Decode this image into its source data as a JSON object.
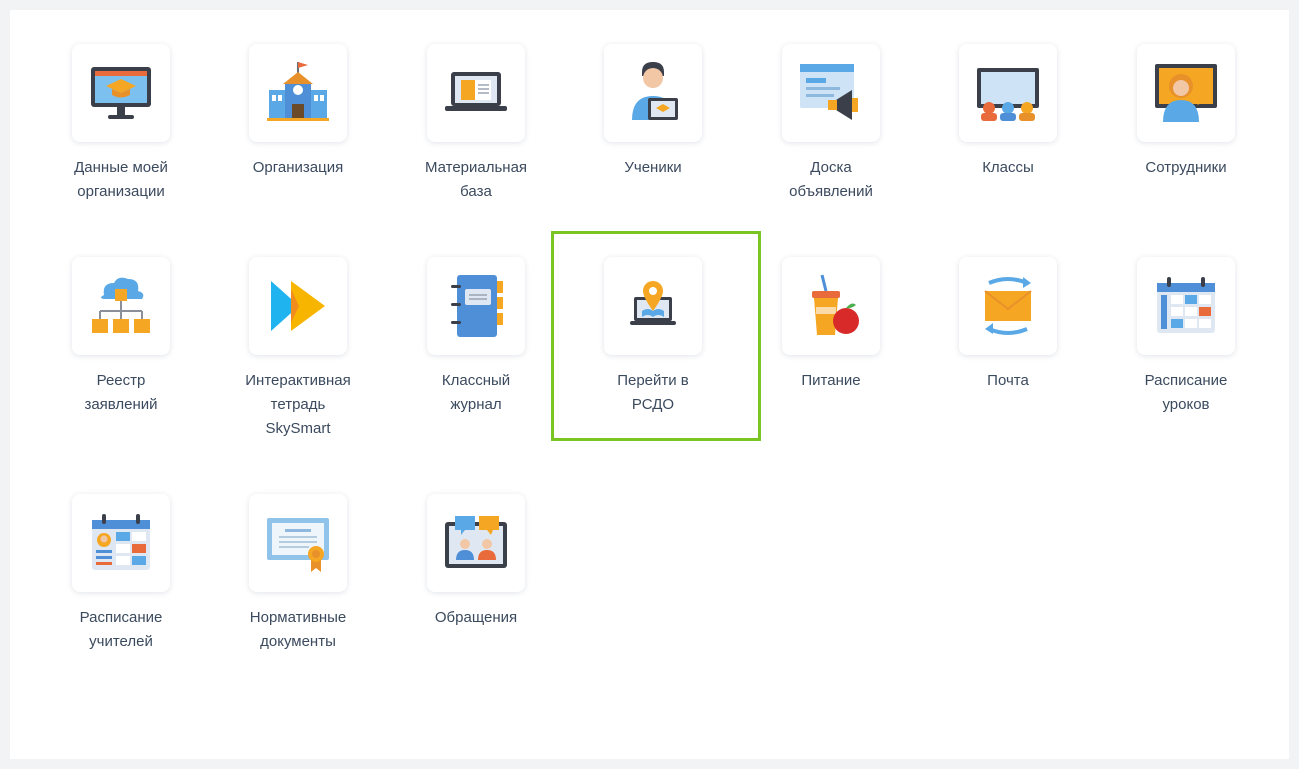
{
  "tiles": [
    {
      "label": "Данные моей\nорганизации",
      "icon": "monitor-graduation-cap-icon"
    },
    {
      "label": "Организация",
      "icon": "school-building-icon"
    },
    {
      "label": "Материальная\nбаза",
      "icon": "laptop-document-icon"
    },
    {
      "label": "Ученики",
      "icon": "student-laptop-icon"
    },
    {
      "label": "Доска\nобъявлений",
      "icon": "announcement-board-megaphone-icon"
    },
    {
      "label": "Классы",
      "icon": "classroom-board-icon"
    },
    {
      "label": "Сотрудники",
      "icon": "teacher-board-icon"
    },
    {
      "label": "Реестр\nзаявлений",
      "icon": "cloud-network-icon"
    },
    {
      "label": "Интерактивная\nтетрадь\nSkySmart",
      "icon": "play-arrows-icon"
    },
    {
      "label": "Классный\nжурнал",
      "icon": "notebook-journal-icon"
    },
    {
      "label": "Перейти в\nРСДО",
      "icon": "laptop-location-pin-icon"
    },
    {
      "label": "Питание",
      "icon": "drink-apple-icon"
    },
    {
      "label": "Почта",
      "icon": "envelope-sync-icon"
    },
    {
      "label": "Расписание\nуроков",
      "icon": "calendar-schedule-icon"
    },
    {
      "label": "Расписание\nучителей",
      "icon": "calendar-teacher-icon"
    },
    {
      "label": "Нормативные\nдокументы",
      "icon": "certificate-icon"
    },
    {
      "label": "Обращения",
      "icon": "chat-people-icon"
    }
  ],
  "highlighted_tile": "Перейти в\nРСДО",
  "colors": {
    "highlight_border": "#7ac520",
    "label_text": "#3b4a5e",
    "accent_orange": "#f5a623",
    "accent_blue": "#5aa9e6",
    "dark": "#3a3f4a"
  }
}
